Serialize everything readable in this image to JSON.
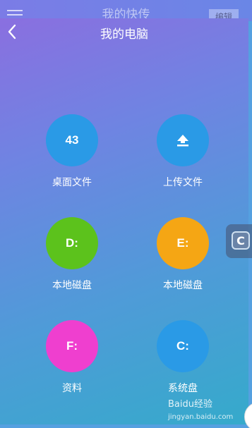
{
  "background_app": {
    "title": "我的快传",
    "edit_label": "编辑"
  },
  "panel": {
    "title": "我的电脑",
    "back_icon": "chevron-left-icon"
  },
  "tiles": [
    {
      "value": "43",
      "label": "桌面文件",
      "color": "#2a9ae6"
    },
    {
      "value": "⬆",
      "label": "上传文件",
      "color": "#2a9ae6",
      "icon": "upload-icon"
    },
    {
      "value": "D:",
      "label": "本地磁盘",
      "color": "#5cc21c"
    },
    {
      "value": "E:",
      "label": "本地磁盘",
      "color": "#f5a614"
    },
    {
      "value": "F:",
      "label": "资料",
      "color": "#ef3fcf"
    },
    {
      "value": "C:",
      "label": "系统盘",
      "color": "#2a9ae6"
    }
  ],
  "side_handle": {
    "glyph": "C"
  },
  "watermark": {
    "text": "Baidu经验",
    "sub": "jingyan.baidu.com"
  }
}
